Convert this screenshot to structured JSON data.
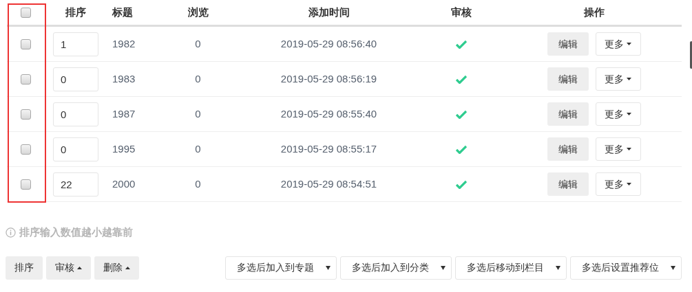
{
  "table": {
    "select_all": {
      "checked": false
    },
    "columns": [
      "排序",
      "标题",
      "浏览",
      "添加时间",
      "审核",
      "操作"
    ],
    "rows": [
      {
        "checked": false,
        "sort": "1",
        "title": "1982",
        "views": "0",
        "added": "2019-05-29 08:56:40",
        "approved": true,
        "edit": "编辑",
        "more": "更多"
      },
      {
        "checked": false,
        "sort": "0",
        "title": "1983",
        "views": "0",
        "added": "2019-05-29 08:56:19",
        "approved": true,
        "edit": "编辑",
        "more": "更多"
      },
      {
        "checked": false,
        "sort": "0",
        "title": "1987",
        "views": "0",
        "added": "2019-05-29 08:55:40",
        "approved": true,
        "edit": "编辑",
        "more": "更多"
      },
      {
        "checked": false,
        "sort": "0",
        "title": "1995",
        "views": "0",
        "added": "2019-05-29 08:55:17",
        "approved": true,
        "edit": "编辑",
        "more": "更多"
      },
      {
        "checked": false,
        "sort": "22",
        "title": "2000",
        "views": "0",
        "added": "2019-05-29 08:54:51",
        "approved": true,
        "edit": "编辑",
        "more": "更多"
      }
    ]
  },
  "hint": "排序输入数值越小越靠前",
  "actions": [
    {
      "label": "排序",
      "dropup": false
    },
    {
      "label": "审核",
      "dropup": true
    },
    {
      "label": "删除",
      "dropup": true
    }
  ],
  "selects": [
    "多选后加入到专题",
    "多选后加入到分类",
    "多选后移动到栏目",
    "多选后设置推荐位"
  ]
}
